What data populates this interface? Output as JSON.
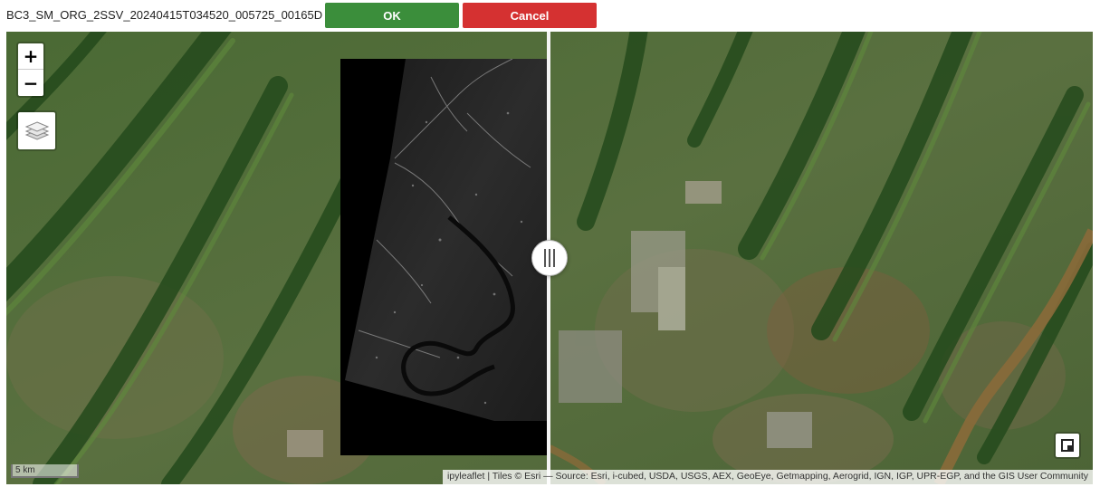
{
  "toolbar": {
    "file_name": "BC3_SM_ORG_2SSV_20240415T034520_005725_00165D",
    "ok_label": "OK",
    "cancel_label": "Cancel"
  },
  "map": {
    "zoom_in_label": "+",
    "zoom_out_label": "−",
    "layers_icon": "layers-icon",
    "fullscreen_icon": "fullscreen-icon",
    "split_handle_icon": "grip-icon",
    "scale_label": "5 km",
    "attribution": "ipyleaflet | Tiles © Esri — Source: Esri, i-cubed, USDA, USGS, AEX, GeoEye, Getmapping, Aerogrid, IGN, IGP, UPR-EGP, and the GIS User Community"
  },
  "colors": {
    "ok": "#3b8e3b",
    "cancel": "#d53131",
    "terrain_base": "#3f5a2e",
    "river": "#8a6a3a"
  }
}
